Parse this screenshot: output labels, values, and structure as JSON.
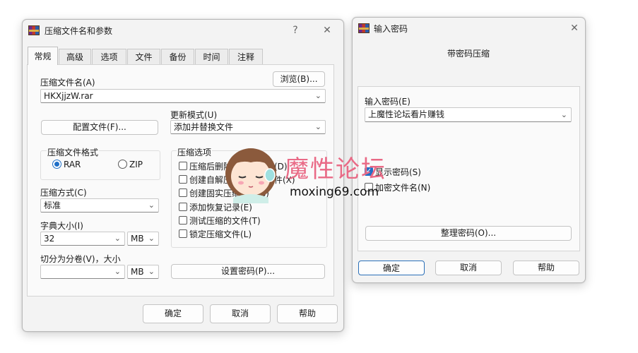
{
  "main_window": {
    "title": "压缩文件名和参数",
    "help_btn": "?",
    "close_btn": "✕",
    "tabs": [
      "常规",
      "高级",
      "选项",
      "文件",
      "备份",
      "时间",
      "注释"
    ],
    "archive_name_label": "压缩文件名(A)",
    "browse_btn": "浏览(B)...",
    "archive_name_value": "HKXjjzW.rar",
    "update_mode_label": "更新模式(U)",
    "update_mode_value": "添加并替换文件",
    "profiles_btn": "配置文件(F)...",
    "format_group_label": "压缩文件格式",
    "format_rar": "RAR",
    "format_zip": "ZIP",
    "options_group_label": "压缩选项",
    "options": [
      "压缩后删除原来的文件(D)",
      "创建自解压格式压缩文件(X)",
      "创建固实压缩文件(S)",
      "添加恢复记录(E)",
      "测试压缩的文件(T)",
      "锁定压缩文件(L)"
    ],
    "method_label": "压缩方式(C)",
    "method_value": "标准",
    "dict_label": "字典大小(I)",
    "dict_value": "32",
    "dict_unit": "MB",
    "split_label": "切分为分卷(V)，大小",
    "split_value": "",
    "split_unit": "MB",
    "set_password_btn": "设置密码(P)...",
    "ok_btn": "确定",
    "cancel_btn": "取消",
    "help_btn_bottom": "帮助"
  },
  "password_dialog": {
    "title": "输入密码",
    "close_btn": "✕",
    "header": "带密码压缩",
    "enter_password_label": "输入密码(E)",
    "password_value": "上魔性论坛看片赚钱",
    "show_password_label": "显示密码(S)",
    "show_password_checked": true,
    "encrypt_names_label": "加密文件名(N)",
    "encrypt_names_checked": false,
    "organize_btn": "整理密码(O)...",
    "ok_btn": "确定",
    "cancel_btn": "取消",
    "help_btn": "帮助"
  },
  "watermark": {
    "text": "魔性论坛",
    "url": "moxing69.com"
  },
  "icons": [
    "winrar-icon",
    "question-icon",
    "close-icon",
    "chevron-down-icon",
    "checkmark-icon",
    "girl-mascot-icon"
  ]
}
